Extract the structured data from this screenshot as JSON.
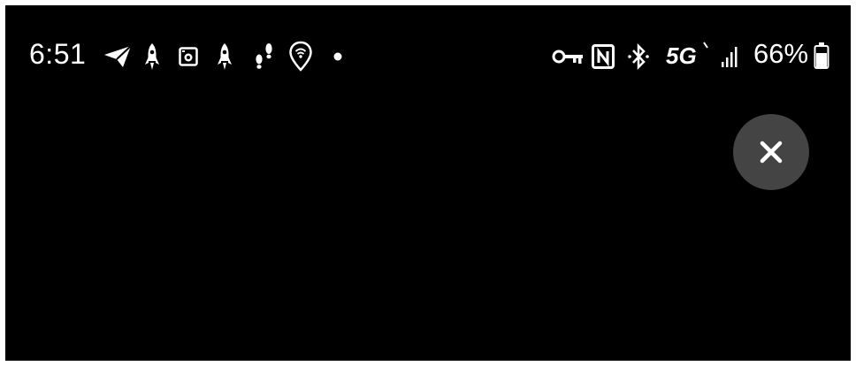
{
  "status_bar": {
    "time": "6:51",
    "left_icons": [
      "telegram-icon",
      "rocket-icon",
      "camera-icon",
      "rocket-icon",
      "footsteps-icon",
      "location-pin-icon",
      "notification-dot-icon"
    ],
    "network_label": "5G",
    "battery_percent": "66%",
    "right_icons": [
      "vpn-key-icon",
      "nfc-icon",
      "bluetooth-icon",
      "signal-strength-icon",
      "battery-icon"
    ]
  },
  "overlay": {
    "close_icon": "close-icon",
    "close_button_color": "#444444"
  },
  "colors": {
    "background": "#000000",
    "foreground": "#ffffff"
  }
}
